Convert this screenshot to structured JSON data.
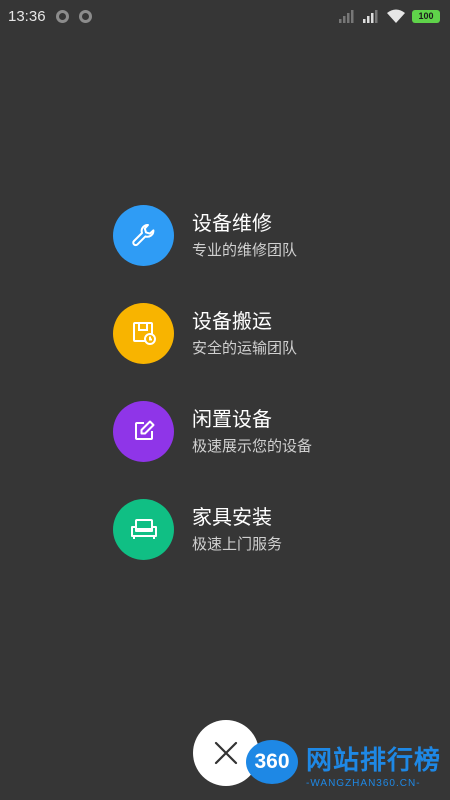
{
  "status_bar": {
    "time": "13:36",
    "battery": "100"
  },
  "menu": {
    "items": [
      {
        "title": "设备维修",
        "subtitle": "专业的维修团队",
        "icon": "wrench-icon",
        "color": "#2f9cf5"
      },
      {
        "title": "设备搬运",
        "subtitle": "安全的运输团队",
        "icon": "delivery-box-icon",
        "color": "#f8b400"
      },
      {
        "title": "闲置设备",
        "subtitle": "极速展示您的设备",
        "icon": "edit-icon",
        "color": "#8f35e8"
      },
      {
        "title": "家具安装",
        "subtitle": "极速上门服务",
        "icon": "sofa-icon",
        "color": "#10bf84"
      }
    ]
  },
  "close_button": {
    "icon": "close-icon"
  },
  "watermark": {
    "badge": "360",
    "name": "网站排行榜",
    "domain": "-WANGZHAN360.CN-"
  }
}
